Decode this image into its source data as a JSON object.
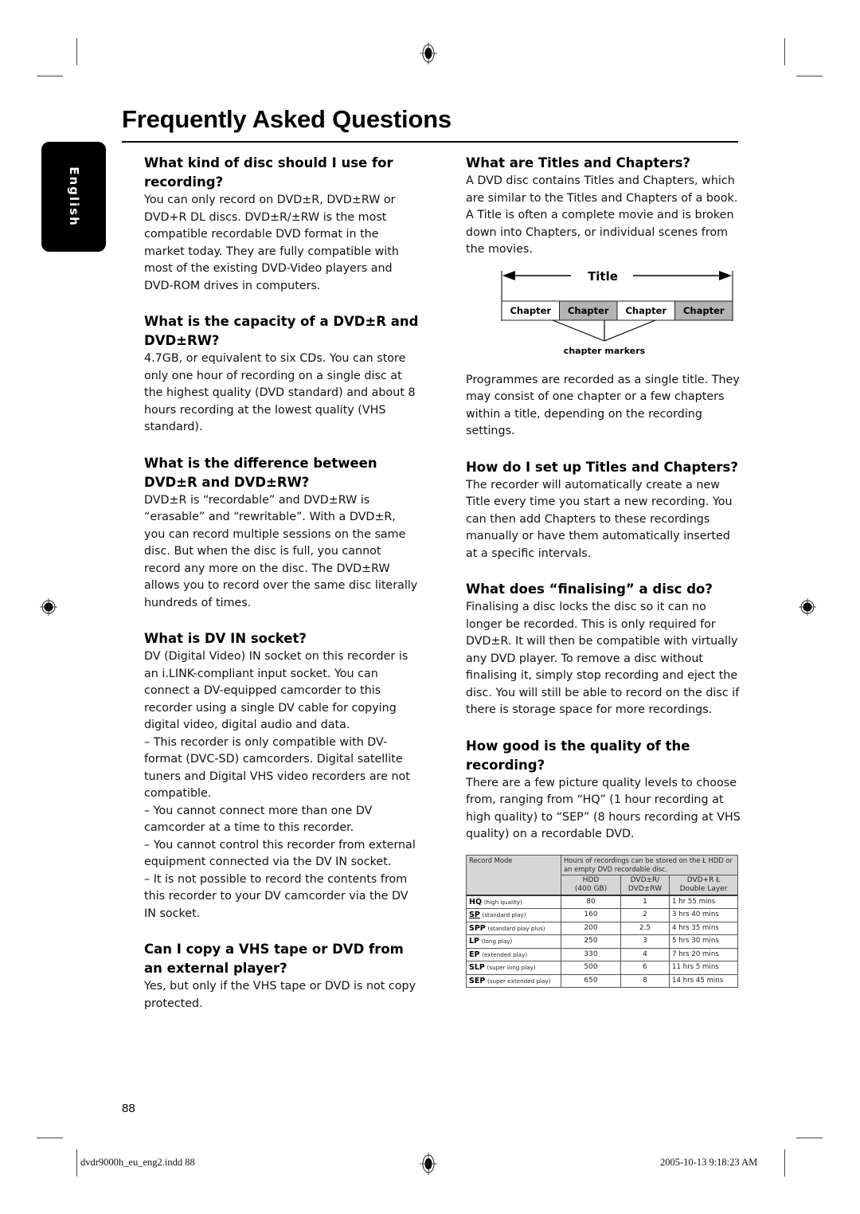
{
  "page": {
    "title": "Frequently Asked Questions",
    "language_tab": "English",
    "page_number": "88"
  },
  "left_column": [
    {
      "question": "What kind of disc should I use for recording?",
      "answer": [
        "You can only record on DVD±R, DVD±RW or DVD+R DL discs. DVD±R/±RW is the most compatible recordable DVD format in the market today. They are fully compatible with most of the existing DVD-Video players and DVD-ROM drives in computers."
      ]
    },
    {
      "question": "What is the capacity of a DVD±R and DVD±RW?",
      "answer": [
        "4.7GB, or equivalent to six CDs. You can store only one hour of recording on a single disc at the highest quality (DVD standard) and about 8 hours recording at the lowest quality (VHS standard)."
      ]
    },
    {
      "question": "What is the difference between DVD±R and DVD±RW?",
      "answer": [
        "DVD±R is “recordable” and DVD±RW is “erasable” and “rewritable”. With a DVD±R, you can record multiple sessions on the same disc. But when the disc is full, you cannot record any more on the disc. The DVD±RW allows you to record over the same disc literally hundreds of times."
      ]
    },
    {
      "question": "What is DV IN socket?",
      "answer": [
        "DV (Digital Video) IN socket on this recorder is an i.LINK-compliant input socket. You can connect a DV-equipped camcorder to this recorder using a single DV cable for copying digital video, digital audio and data.",
        "–   This recorder is only compatible with DV-format (DVC-SD) camcorders. Digital satellite tuners and Digital VHS video recorders are not compatible.",
        "–   You cannot connect more than one DV camcorder at a time to this recorder.",
        "–   You cannot control this recorder from external equipment connected via the DV IN socket.",
        "–   It is not possible to record the contents from this recorder to your DV camcorder via the DV IN socket."
      ]
    },
    {
      "question": "Can I copy a VHS tape or DVD from an external player?",
      "answer": [
        "Yes, but only if the VHS tape or DVD is not copy protected."
      ]
    }
  ],
  "right_column": [
    {
      "question": "What are Titles and Chapters?",
      "answer": [
        "A DVD disc contains Titles and Chapters, which are similar to the Titles and Chapters of a book.  A Title is often a complete movie and is broken down into Chapters, or individual scenes from the movies."
      ]
    },
    {
      "question": "",
      "answer": [
        "Programmes are recorded as a single title. They may consist of one chapter or a few chapters within a title, depending on the recording settings."
      ]
    },
    {
      "question": "How do I set up Titles and Chapters?",
      "answer": [
        "The recorder will automatically create a new Title every time you start a new recording. You can then add Chapters to these recordings manually or have them automatically inserted at a specific intervals."
      ]
    },
    {
      "question": "What does “finalising” a disc do?",
      "answer": [
        "Finalising a disc locks the disc so it can no longer be recorded. This is only required for DVD±R. It will then be compatible with virtually any DVD player. To remove a disc without finalising it, simply stop recording and eject the disc. You will still be able to record on the disc if there is storage space for more recordings."
      ]
    },
    {
      "question": "How good is the quality of the recording?",
      "answer": [
        "There are a few picture quality levels to choose from, ranging from “HQ” (1 hour recording at high quality) to “SEP” (8 hours recording at VHS quality) on a recordable DVD."
      ]
    }
  ],
  "diagram": {
    "title_label": "Title",
    "chapters": [
      {
        "label": "Chapter",
        "shaded": false
      },
      {
        "label": "Chapter",
        "shaded": true
      },
      {
        "label": "Chapter",
        "shaded": false
      },
      {
        "label": "Chapter",
        "shaded": true
      }
    ],
    "markers_label": "chapter markers",
    "shade_color": "#b4b4b4"
  },
  "record_table": {
    "header_mode": "Record Mode",
    "header_hours": "Hours of recordings can be stored on the Ł HDD or an empty DVD recordable disc.",
    "sub_headers": [
      [
        "HDD",
        "(400 GB)"
      ],
      [
        "DVD±R/",
        "DVD±RW"
      ],
      [
        "DVD+R Ł",
        "Double Layer"
      ]
    ],
    "rows": [
      {
        "code": "HQ",
        "desc": "(high quality)",
        "hdd": "80",
        "dvd": "1",
        "dl": "1 hr 55 mins",
        "underline": false
      },
      {
        "code": "SP",
        "desc": "(standard play)",
        "hdd": "160",
        "dvd": "2",
        "dl": "3 hrs 40 mins",
        "underline": true
      },
      {
        "code": "SPP",
        "desc": "(standard play plus)",
        "hdd": "200",
        "dvd": "2.5",
        "dl": "4 hrs 35 mins",
        "underline": false
      },
      {
        "code": "LP",
        "desc": "(long play)",
        "hdd": "250",
        "dvd": "3",
        "dl": "5 hrs 30 mins",
        "underline": false
      },
      {
        "code": "EP",
        "desc": "(extended play)",
        "hdd": "330",
        "dvd": "4",
        "dl": "7 hrs 20 mins",
        "underline": false
      },
      {
        "code": "SLP",
        "desc": "(super long play)",
        "hdd": "500",
        "dvd": "6",
        "dl": "11 hrs 5 mins",
        "underline": false
      },
      {
        "code": "SEP",
        "desc": "(super extended play)",
        "hdd": "650",
        "dvd": "8",
        "dl": "14 hrs 45 mins",
        "underline": false
      }
    ]
  },
  "footer": {
    "file_info": "dvdr9000h_eu_eng2.indd   88",
    "timestamp": "2005-10-13   9:18:23 AM"
  },
  "icons": {
    "registration_mark": "registration-crosshair"
  }
}
